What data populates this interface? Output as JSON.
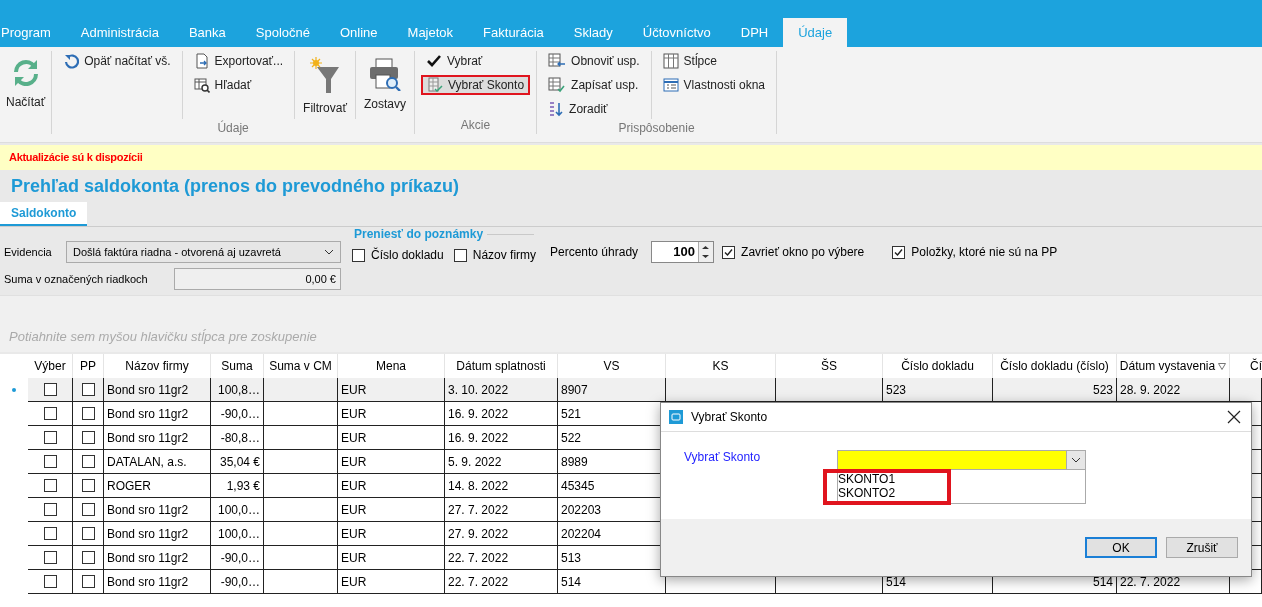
{
  "menu_tabs": [
    {
      "label": "Program",
      "selected": false
    },
    {
      "label": "Administrácia",
      "selected": false
    },
    {
      "label": "Banka",
      "selected": false
    },
    {
      "label": "Spoločné",
      "selected": false
    },
    {
      "label": "Online",
      "selected": false
    },
    {
      "label": "Majetok",
      "selected": false
    },
    {
      "label": "Fakturácia",
      "selected": false
    },
    {
      "label": "Sklady",
      "selected": false
    },
    {
      "label": "Účtovníctvo",
      "selected": false
    },
    {
      "label": "DPH",
      "selected": false
    },
    {
      "label": "Údaje",
      "selected": true
    }
  ],
  "ribbon": {
    "groups": [
      {
        "columns": [
          [
            {
              "label": "Načítať",
              "kind": "large",
              "highlighted": false
            }
          ]
        ]
      },
      {
        "label": "Údaje",
        "columns": [
          [
            {
              "label": "Opäť načítať vš.",
              "kind": "small",
              "highlighted": false
            }
          ],
          [
            {
              "label": "Exportovať...",
              "kind": "small",
              "highlighted": false
            },
            {
              "label": "Hľadať",
              "kind": "small",
              "highlighted": false
            }
          ],
          [
            {
              "label": "Filtrovať",
              "kind": "large",
              "highlighted": false
            }
          ],
          [
            {
              "label": "Zostavy",
              "kind": "large",
              "highlighted": false
            }
          ]
        ]
      },
      {
        "label": "Akcie",
        "columns": [
          [
            {
              "label": "Vybrať",
              "kind": "small",
              "highlighted": false
            },
            {
              "label": "Vybrať Skonto",
              "kind": "small",
              "highlighted": true
            }
          ]
        ]
      },
      {
        "label": "Prispôsobenie",
        "columns": [
          [
            {
              "label": "Obnoviť usp.",
              "kind": "small",
              "highlighted": false
            },
            {
              "label": "Zapísať usp.",
              "kind": "small",
              "highlighted": false
            },
            {
              "label": "Zoradiť",
              "kind": "small",
              "highlighted": false
            }
          ],
          [
            {
              "label": "Stĺpce",
              "kind": "small",
              "highlighted": false
            },
            {
              "label": "Vlastnosti okna",
              "kind": "small",
              "highlighted": false
            }
          ]
        ]
      }
    ]
  },
  "notice": "Aktualizácie sú k dispozícii",
  "title": "Prehľad saldokonta (prenos do prevodného príkazu)",
  "view_tabs": [
    {
      "label": "Saldokonto",
      "selected": true
    }
  ],
  "filters": {
    "evidencia": {
      "label": "Evidencia",
      "value": "Došlá faktúra riadna - otvorená aj uzavretá"
    },
    "suma": {
      "label": "Suma v označených riadkoch",
      "value": "0,00 €"
    },
    "prenos": {
      "legend": "Preniesť do poznámky",
      "options": [
        {
          "label": "Číslo dokladu",
          "checked": false
        },
        {
          "label": "Názov firmy",
          "checked": false
        }
      ]
    },
    "percento": {
      "label": "Percento úhrady",
      "value": "100"
    },
    "options": [
      {
        "label": "Zavrieť okno po výbere",
        "checked": true
      },
      {
        "label": "Položky, ktoré nie sú na PP",
        "checked": true
      }
    ]
  },
  "group_hint": "Potiahnite sem myšou hlavičku stĺpca pre zoskupenie",
  "grid": {
    "columns": [
      "Výber",
      "PP",
      "Názov firmy",
      "Suma",
      "Suma v CM",
      "Mena",
      "Dátum splatnosti",
      "VS",
      "KS",
      "ŠS",
      "Číslo dokladu",
      "Číslo dokladu (číslo)",
      "Dátum vystavenia",
      "Čí"
    ],
    "rows": [
      {
        "selected": true,
        "vyber": false,
        "pp": false,
        "firma": "Bond sro 11gr2",
        "suma": "100,8…",
        "mena": "EUR",
        "splatnost": "3. 10. 2022",
        "vs": "8907",
        "doklad": "523",
        "doklad_cislo": "523",
        "vystavenie": "28. 9. 2022"
      },
      {
        "selected": false,
        "vyber": false,
        "pp": false,
        "firma": "Bond sro 11gr2",
        "suma": "-90,0…",
        "mena": "EUR",
        "splatnost": "16. 9. 2022",
        "vs": "521"
      },
      {
        "selected": false,
        "vyber": false,
        "pp": false,
        "firma": "Bond sro 11gr2",
        "suma": "-80,8…",
        "mena": "EUR",
        "splatnost": "16. 9. 2022",
        "vs": "522"
      },
      {
        "selected": false,
        "vyber": false,
        "pp": false,
        "firma": "DATALAN, a.s.",
        "suma": "35,04 €",
        "mena": "EUR",
        "splatnost": "5. 9. 2022",
        "vs": "8989"
      },
      {
        "selected": false,
        "vyber": false,
        "pp": false,
        "firma": "ROGER",
        "suma": "1,93 €",
        "mena": "EUR",
        "splatnost": "14. 8. 2022",
        "vs": "45345"
      },
      {
        "selected": false,
        "vyber": false,
        "pp": false,
        "firma": "Bond sro 11gr2",
        "suma": "100,0…",
        "mena": "EUR",
        "splatnost": "27. 7. 2022",
        "vs": "202203"
      },
      {
        "selected": false,
        "vyber": false,
        "pp": false,
        "firma": "Bond sro 11gr2",
        "suma": "100,0…",
        "mena": "EUR",
        "splatnost": "27. 9. 2022",
        "vs": "202204"
      },
      {
        "selected": false,
        "vyber": false,
        "pp": false,
        "firma": "Bond sro 11gr2",
        "suma": "-90,0…",
        "mena": "EUR",
        "splatnost": "22. 7. 2022",
        "vs": "513"
      },
      {
        "selected": false,
        "vyber": false,
        "pp": false,
        "firma": "Bond sro 11gr2",
        "suma": "-90,0…",
        "mena": "EUR",
        "splatnost": "22. 7. 2022",
        "vs": "514",
        "doklad": "514",
        "doklad_cislo": "514",
        "vystavenie": "22. 7. 2022"
      }
    ]
  },
  "dialog": {
    "title": "Vybrať Skonto",
    "label": "Vybrať Skonto",
    "highlighted": true,
    "options": [
      "SKONTO1",
      "SKONTO2"
    ],
    "buttons": [
      "OK",
      "Zrušiť"
    ]
  }
}
